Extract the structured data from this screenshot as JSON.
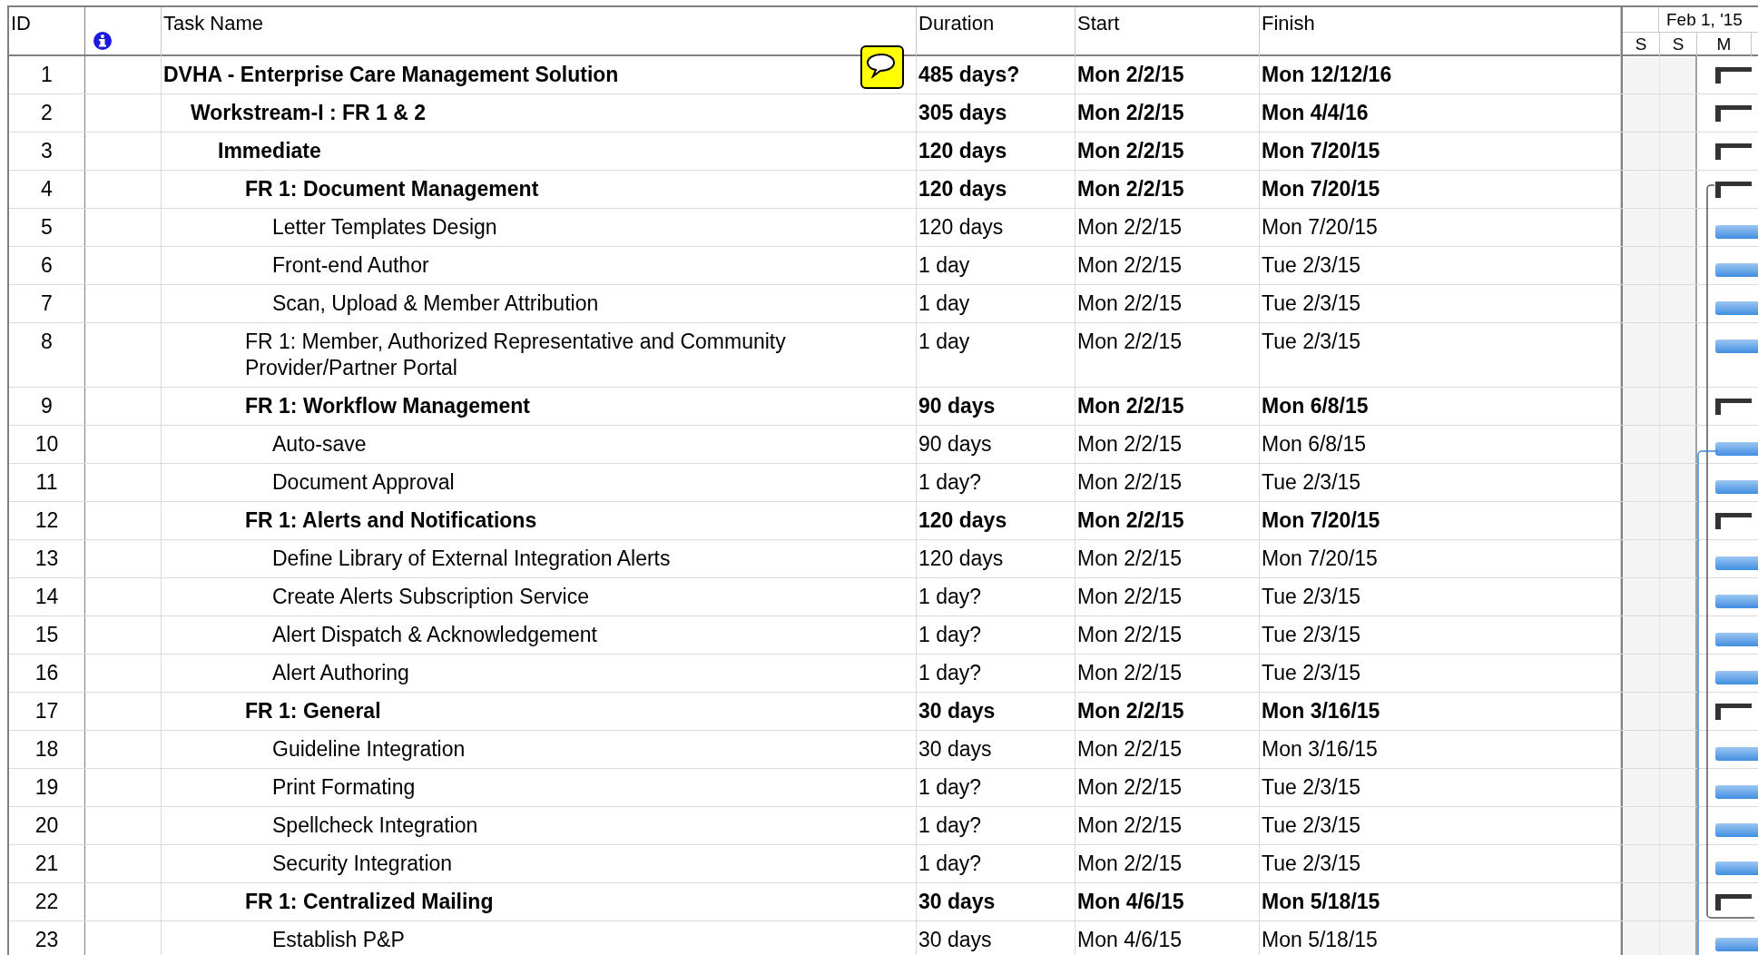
{
  "columns": {
    "id": "ID",
    "task_name": "Task Name",
    "duration": "Duration",
    "start": "Start",
    "finish": "Finish"
  },
  "timescale": {
    "week": "Feb 1, '15",
    "days": [
      "S",
      "S",
      "M"
    ]
  },
  "tasks": [
    {
      "id": "1",
      "name": "DVHA - Enterprise Care Management Solution",
      "duration": "485 days?",
      "start": "Mon 2/2/15",
      "finish": "Mon 12/12/16",
      "summary": true,
      "children": [
        {
          "id": "2",
          "name": "Workstream-I : FR 1 & 2",
          "duration": "305 days",
          "start": "Mon 2/2/15",
          "finish": "Mon 4/4/16",
          "summary": true,
          "children": [
            {
              "id": "3",
              "name": "Immediate",
              "duration": "120 days",
              "start": "Mon 2/2/15",
              "finish": "Mon 7/20/15",
              "summary": true,
              "children": [
                {
                  "id": "4",
                  "name": "FR 1: Document Management",
                  "duration": "120 days",
                  "start": "Mon 2/2/15",
                  "finish": "Mon 7/20/15",
                  "summary": true,
                  "children": [
                    {
                      "id": "5",
                      "name": "Letter Templates Design",
                      "duration": "120 days",
                      "start": "Mon 2/2/15",
                      "finish": "Mon 7/20/15",
                      "summary": false
                    },
                    {
                      "id": "6",
                      "name": "Front-end Author",
                      "duration": "1 day",
                      "start": "Mon 2/2/15",
                      "finish": "Tue 2/3/15",
                      "summary": false
                    },
                    {
                      "id": "7",
                      "name": "Scan, Upload & Member Attribution",
                      "duration": "1 day",
                      "start": "Mon 2/2/15",
                      "finish": "Tue 2/3/15",
                      "summary": false
                    }
                  ]
                },
                {
                  "id": "8",
                  "name": "FR 1: Member, Authorized Representative and Community Provider/Partner Portal",
                  "duration": "1 day",
                  "start": "Mon 2/2/15",
                  "finish": "Tue 2/3/15",
                  "summary": false
                },
                {
                  "id": "9",
                  "name": "FR 1: Workflow Management",
                  "duration": "90 days",
                  "start": "Mon 2/2/15",
                  "finish": "Mon 6/8/15",
                  "summary": true,
                  "children": [
                    {
                      "id": "10",
                      "name": "Auto-save",
                      "duration": "90 days",
                      "start": "Mon 2/2/15",
                      "finish": "Mon 6/8/15",
                      "summary": false
                    },
                    {
                      "id": "11",
                      "name": "Document Approval",
                      "duration": "1 day?",
                      "start": "Mon 2/2/15",
                      "finish": "Tue 2/3/15",
                      "summary": false
                    }
                  ]
                },
                {
                  "id": "12",
                  "name": "FR 1: Alerts and Notifications",
                  "duration": "120 days",
                  "start": "Mon 2/2/15",
                  "finish": "Mon 7/20/15",
                  "summary": true,
                  "children": [
                    {
                      "id": "13",
                      "name": "Define Library of External Integration Alerts",
                      "duration": "120 days",
                      "start": "Mon 2/2/15",
                      "finish": "Mon 7/20/15",
                      "summary": false
                    },
                    {
                      "id": "14",
                      "name": "Create Alerts Subscription Service",
                      "duration": "1 day?",
                      "start": "Mon 2/2/15",
                      "finish": "Tue 2/3/15",
                      "summary": false
                    },
                    {
                      "id": "15",
                      "name": "Alert Dispatch & Acknowledgement",
                      "duration": "1 day?",
                      "start": "Mon 2/2/15",
                      "finish": "Tue 2/3/15",
                      "summary": false
                    },
                    {
                      "id": "16",
                      "name": "Alert Authoring",
                      "duration": "1 day?",
                      "start": "Mon 2/2/15",
                      "finish": "Tue 2/3/15",
                      "summary": false
                    }
                  ]
                },
                {
                  "id": "17",
                  "name": "FR 1: General",
                  "duration": "30 days",
                  "start": "Mon 2/2/15",
                  "finish": "Mon 3/16/15",
                  "summary": true,
                  "children": [
                    {
                      "id": "18",
                      "name": "Guideline Integration",
                      "duration": "30 days",
                      "start": "Mon 2/2/15",
                      "finish": "Mon 3/16/15",
                      "summary": false
                    },
                    {
                      "id": "19",
                      "name": "Print Formating",
                      "duration": "1 day?",
                      "start": "Mon 2/2/15",
                      "finish": "Tue 2/3/15",
                      "summary": false
                    },
                    {
                      "id": "20",
                      "name": "Spellcheck Integration",
                      "duration": "1 day?",
                      "start": "Mon 2/2/15",
                      "finish": "Tue 2/3/15",
                      "summary": false
                    },
                    {
                      "id": "21",
                      "name": "Security Integration",
                      "duration": "1 day?",
                      "start": "Mon 2/2/15",
                      "finish": "Tue 2/3/15",
                      "summary": false
                    }
                  ]
                },
                {
                  "id": "22",
                  "name": "FR 1: Centralized Mailing",
                  "duration": "30 days",
                  "start": "Mon 4/6/15",
                  "finish": "Mon 5/18/15",
                  "summary": true,
                  "children": [
                    {
                      "id": "23",
                      "name": "Establish P&P",
                      "duration": "30 days",
                      "start": "Mon 4/6/15",
                      "finish": "Mon 5/18/15",
                      "summary": false
                    }
                  ]
                }
              ]
            }
          ]
        }
      ]
    }
  ]
}
